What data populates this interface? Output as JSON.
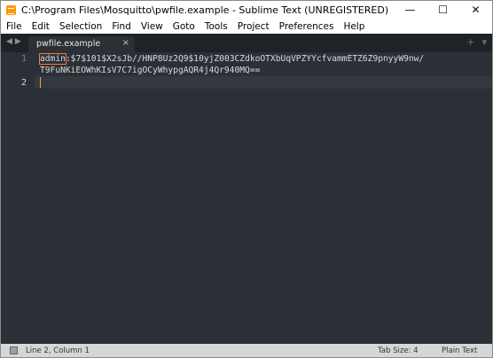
{
  "window": {
    "title": "C:\\Program Files\\Mosquitto\\pwfile.example - Sublime Text (UNREGISTERED)",
    "controls": {
      "minimize": "—",
      "maximize": "☐",
      "close": "✕"
    }
  },
  "menu": {
    "items": [
      "File",
      "Edit",
      "Selection",
      "Find",
      "View",
      "Goto",
      "Tools",
      "Project",
      "Preferences",
      "Help"
    ]
  },
  "tabs": {
    "active": {
      "label": "pwfile.example",
      "close": "×"
    },
    "nav_back": "◀",
    "nav_forward": "▶",
    "new_tab": "+",
    "tab_menu": "▾"
  },
  "editor": {
    "line_numbers": [
      "1",
      "2"
    ],
    "current_line": 2,
    "lines": [
      {
        "highlighted_word": "admin",
        "rest": ":$7$101$X2sJb//HNP8Uz2Q9$10yjZ003CZdkoOTXbUqVPZYYcfvammETZ6Z9pnyyW9nw/",
        "wrap": "T9FuNKiEOWhKIsV7C7igOCyWhypgAQR4j4Qr940MQ=="
      },
      {
        "text": ""
      }
    ]
  },
  "status": {
    "position": "Line 2, Column 1",
    "tab_size": "Tab Size: 4",
    "syntax": "Plain Text"
  },
  "colors": {
    "editor_bg": "#2b3036",
    "highlight_outline": "#f57f3a",
    "cursor": "#f0a23c"
  }
}
